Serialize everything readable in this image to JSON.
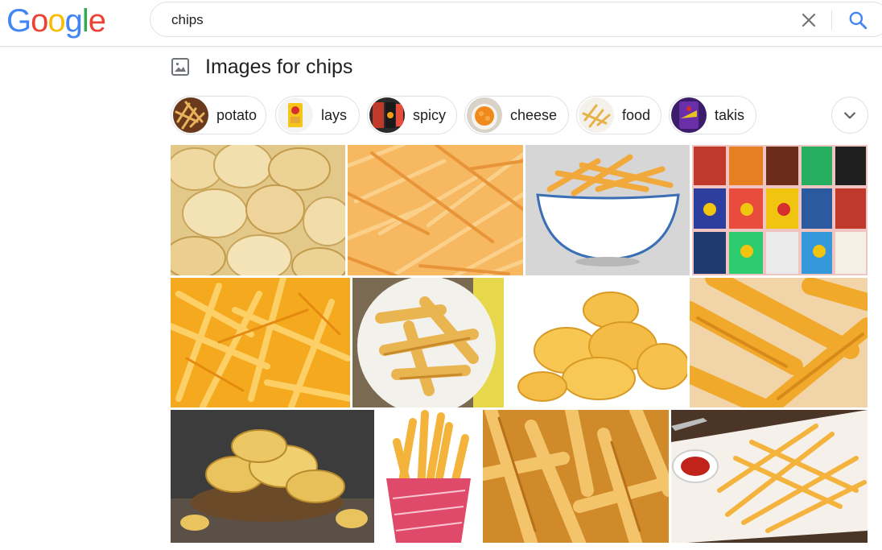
{
  "header": {
    "logo_letters": [
      "G",
      "o",
      "o",
      "g",
      "l",
      "e"
    ],
    "logo_colors": [
      "#4285F4",
      "#EA4335",
      "#FBBC05",
      "#4285F4",
      "#34A853",
      "#EA4335"
    ],
    "search": {
      "query": "chips"
    }
  },
  "images_section": {
    "title": "Images for chips",
    "chips": [
      {
        "label": "potato"
      },
      {
        "label": "lays"
      },
      {
        "label": "spicy"
      },
      {
        "label": "cheese"
      },
      {
        "label": "food"
      },
      {
        "label": "takis"
      }
    ],
    "results": [
      {
        "subject": "potato-chips-closeup"
      },
      {
        "subject": "shoestring-fries"
      },
      {
        "subject": "fries-in-white-bowl"
      },
      {
        "subject": "chip-bags-collage"
      },
      {
        "subject": "golden-fries-pile"
      },
      {
        "subject": "thick-fries-on-plate"
      },
      {
        "subject": "pringles-style-chips"
      },
      {
        "subject": "thick-fries-closeup"
      },
      {
        "subject": "chips-in-wooden-bowl"
      },
      {
        "subject": "fries-in-paper-cup"
      },
      {
        "subject": "crispy-fries-closeup"
      },
      {
        "subject": "fries-with-ketchup-dish"
      }
    ]
  },
  "colors": {
    "accent_blue": "#4285F4",
    "border": "#dfe1e5",
    "fries": "#F2B13C",
    "chips": "#E8C57A"
  }
}
